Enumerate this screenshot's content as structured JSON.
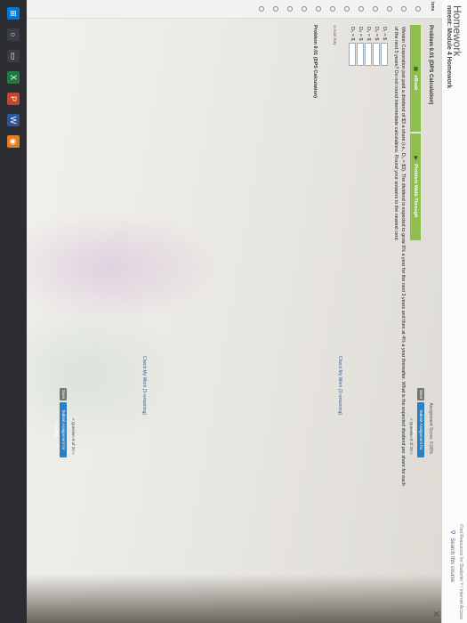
{
  "header": {
    "app_title": "Homework",
    "course_title": "nment: Module 4 Homework",
    "search_label": "Search this course",
    "my_links": "Find Resources for\nStudents™ / Internet Access"
  },
  "left_nav": {
    "label": "ions",
    "item_count": 12
  },
  "problem": {
    "title": "Problem 9.01 (DPS Calculation)",
    "tabs": [
      {
        "label": "eBook",
        "icon": "book-icon"
      },
      {
        "label": "Problem Walk-Through",
        "icon": "video-icon"
      }
    ],
    "question_text": "Weston Corporation just paid a dividend of $3 a share (i.e., D₀ = $3). The dividend is expected to grow 9% a year for the next 3 years and then at 4% a year thereafter. What is the expected dividend per share for each of the next 5 years? Do not round intermediate calculations. Round your answers to the nearest cent.",
    "answers": [
      {
        "label": "D₁ = $"
      },
      {
        "label": "D₂ = $"
      },
      {
        "label": "D₃ = $"
      },
      {
        "label": "D₄ = $"
      },
      {
        "label": "D₅ = $"
      }
    ],
    "check_work": "Check My Work (3 remaining)",
    "key_label": "Icon Key",
    "footer_title": "Problem 9.01 (DPS Calculation)"
  },
  "score": {
    "label": "Assignment Score: 0.00%",
    "save": "Save",
    "submit": "Submit Assignment for Grading",
    "question_nav": "« Question 8 of 20 »"
  },
  "colors": {
    "tab_green": "#8fbf4d",
    "submit_blue": "#2d7fc4",
    "taskbar": "#2b2d33"
  }
}
